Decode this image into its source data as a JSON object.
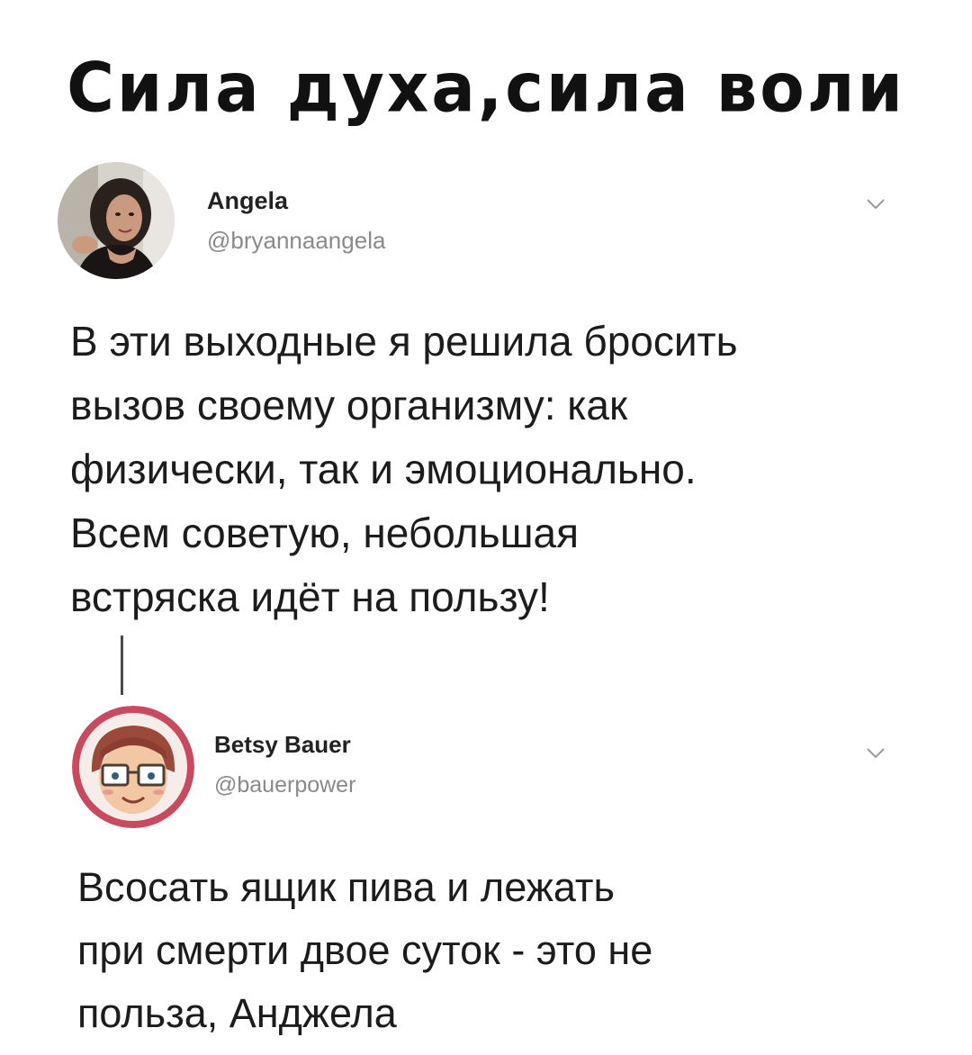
{
  "headline": "Сила духа,сила воли",
  "tweets": [
    {
      "display_name": "Angela",
      "handle": "@bryannaangela",
      "text_lines": [
        "В эти выходные я решила бросить",
        "вызов своему организму: как",
        "физически, так и эмоционально.",
        "Всем советую, небольшая",
        "встряска идёт на пользу!"
      ],
      "avatar_icon": "profile-photo",
      "menu_icon": "chevron-down-icon"
    },
    {
      "display_name": "Betsy Bauer",
      "handle": "@bauerpower",
      "text_lines": [
        "Всосать ящик пива и лежать",
        "при смерти двое суток - это не",
        "польза, Анджела"
      ],
      "avatar_icon": "cartoon-avatar",
      "menu_icon": "chevron-down-icon"
    }
  ],
  "colors": {
    "background": "#ffffff",
    "text": "#1c1c1c",
    "handle": "#8a8a8a",
    "avatar_ring": "#c94a5e"
  }
}
